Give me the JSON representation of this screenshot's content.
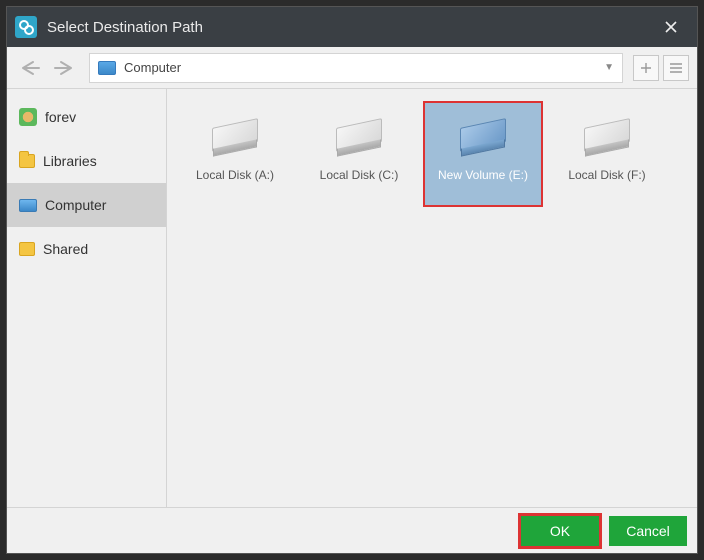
{
  "window": {
    "title": "Select Destination Path"
  },
  "toolbar": {
    "path_label": "Computer"
  },
  "sidebar": {
    "items": [
      {
        "label": "forev"
      },
      {
        "label": "Libraries"
      },
      {
        "label": "Computer"
      },
      {
        "label": "Shared"
      }
    ]
  },
  "drives": [
    {
      "label": "Local Disk (A:)",
      "selected": false
    },
    {
      "label": "Local Disk (C:)",
      "selected": false
    },
    {
      "label": "New Volume (E:)",
      "selected": true
    },
    {
      "label": "Local Disk (F:)",
      "selected": false
    }
  ],
  "footer": {
    "ok_label": "OK",
    "cancel_label": "Cancel"
  }
}
